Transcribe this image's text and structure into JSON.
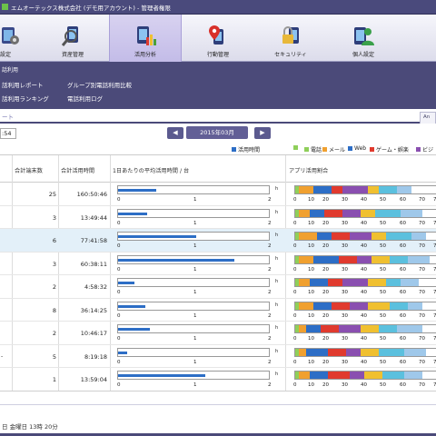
{
  "window": {
    "title": "エムオーテックス株式会社 (デモ用アカウント) - 管理者権限"
  },
  "nav": {
    "items": [
      {
        "label": "設定",
        "icon": "settings-icon"
      },
      {
        "label": "資産管理",
        "icon": "asset-search-icon"
      },
      {
        "label": "活用分析",
        "icon": "analysis-chart-icon"
      },
      {
        "label": "行動管理",
        "icon": "location-pin-icon"
      },
      {
        "label": "セキュリティ",
        "icon": "lock-icon"
      },
      {
        "label": "個人設定",
        "icon": "personal-settings-icon"
      }
    ]
  },
  "subnav": {
    "section": "話利用",
    "row1": [
      "話利用レポート",
      "グループ別電話利用比較"
    ],
    "row2": [
      "話利用ランキング",
      "電話利用ログ"
    ]
  },
  "page": {
    "heading": "ート",
    "tab": "An"
  },
  "controls": {
    "time": ":54",
    "prev_label": "◀",
    "next_label": "▶",
    "month": "2015年03月"
  },
  "legend": {
    "items": [
      {
        "label": "活用時間",
        "color": "#2d6ec6"
      },
      {
        "label": "",
        "color": "#8fcf5a"
      },
      {
        "label": "電話",
        "color": "#8fcf5a"
      },
      {
        "label": "メール",
        "color": "#f0a030"
      },
      {
        "label": "Web",
        "color": "#2d6ec6"
      },
      {
        "label": "ゲーム・娯楽",
        "color": "#e03a2e"
      },
      {
        "label": "ビジ",
        "color": "#8a4fb0"
      }
    ]
  },
  "table": {
    "headers": {
      "count": "合計端末数",
      "total": "合計活用時間",
      "avg": "1日あたりの平均活用時間 / 台",
      "ratio": "アプリ活用割合"
    },
    "unit_h": "h",
    "axis1": [
      "0",
      "1",
      "2"
    ],
    "axis2": [
      "0",
      "10",
      "20",
      "30",
      "40",
      "50",
      "60",
      "70",
      "75"
    ],
    "rows": [
      {
        "count": "25",
        "total": "160:50:46",
        "avg": 0.25,
        "dash": "",
        "selected": false
      },
      {
        "count": "3",
        "total": "13:49:44",
        "avg": 0.19,
        "dash": "",
        "selected": false
      },
      {
        "count": "6",
        "total": "77:41:58",
        "avg": 0.52,
        "dash": "",
        "selected": true
      },
      {
        "count": "3",
        "total": "60:38:11",
        "avg": 0.77,
        "dash": "",
        "selected": false
      },
      {
        "count": "2",
        "total": "4:58:32",
        "avg": 0.11,
        "dash": "",
        "selected": false
      },
      {
        "count": "8",
        "total": "36:14:25",
        "avg": 0.18,
        "dash": "",
        "selected": false
      },
      {
        "count": "2",
        "total": "10:46:17",
        "avg": 0.21,
        "dash": "",
        "selected": false
      },
      {
        "count": "5",
        "total": "8:19:18",
        "avg": 0.06,
        "dash": "-",
        "selected": false
      },
      {
        "count": "1",
        "total": "13:59:04",
        "avg": 0.58,
        "dash": "",
        "selected": false
      }
    ],
    "ratios": [
      [
        2,
        8,
        10,
        6,
        14,
        6,
        10,
        8
      ],
      [
        2,
        6,
        8,
        10,
        10,
        8,
        14,
        12
      ],
      [
        2,
        10,
        8,
        10,
        12,
        8,
        14,
        8
      ],
      [
        2,
        8,
        14,
        10,
        8,
        10,
        10,
        12
      ],
      [
        2,
        6,
        10,
        8,
        14,
        10,
        8,
        10
      ],
      [
        2,
        8,
        10,
        10,
        10,
        12,
        10,
        8
      ],
      [
        2,
        4,
        8,
        10,
        12,
        10,
        10,
        14
      ],
      [
        2,
        4,
        12,
        10,
        8,
        10,
        14,
        12
      ],
      [
        2,
        6,
        10,
        12,
        8,
        10,
        12,
        10
      ]
    ]
  },
  "footer": {
    "status": "日 金曜日 13時 20分"
  }
}
